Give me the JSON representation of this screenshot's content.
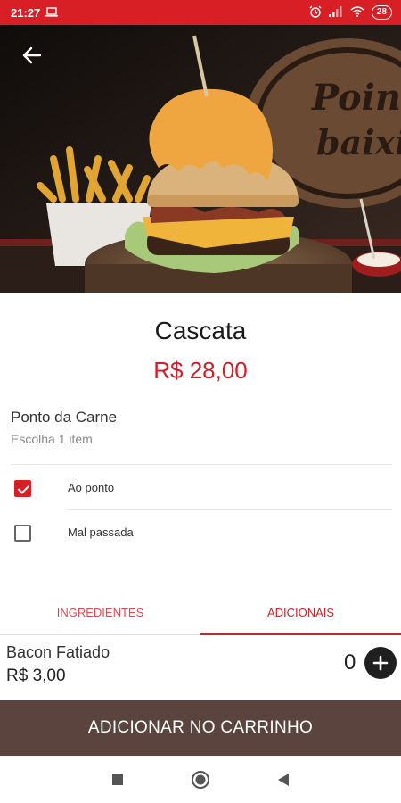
{
  "status_bar": {
    "time": "21:27",
    "battery": "28"
  },
  "hero": {
    "sign_text_1": "Poin",
    "sign_text_2": "baixi"
  },
  "product": {
    "name": "Cascata",
    "price": "R$ 28,00"
  },
  "option_group": {
    "title": "Ponto da Carne",
    "subtitle": "Escolha 1 item",
    "options": [
      {
        "label": "Ao ponto",
        "checked": true
      },
      {
        "label": "Mal passada",
        "checked": false
      }
    ]
  },
  "tabs": [
    {
      "label": "INGREDIENTES",
      "active": false
    },
    {
      "label": "ADICIONAIS",
      "active": true
    }
  ],
  "addon": {
    "name": "Bacon Fatiado",
    "price": "R$ 3,00",
    "quantity": "0"
  },
  "cart_button": {
    "label": "ADICIONAR NO CARRINHO"
  },
  "colors": {
    "brand_red": "#d81f26",
    "cart_button": "#5a443d"
  }
}
